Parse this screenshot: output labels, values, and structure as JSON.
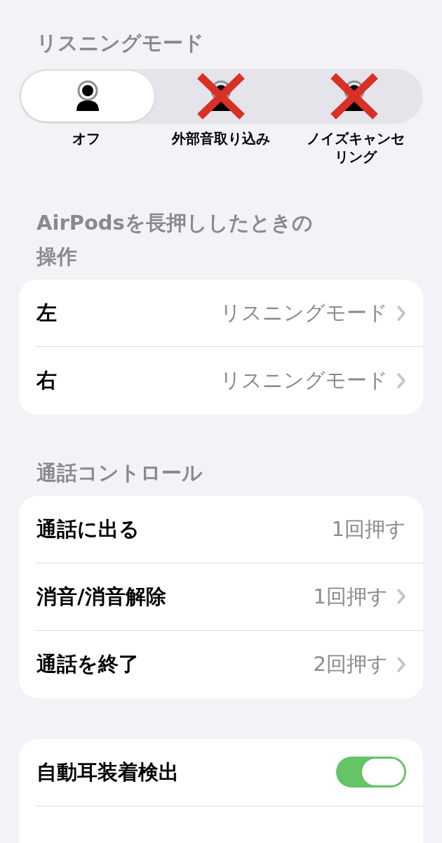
{
  "listening_mode": {
    "title": "リスニングモード",
    "segments": [
      {
        "label": "オフ",
        "selected": true,
        "crossed_out": false
      },
      {
        "label": "外部音取り込み",
        "selected": false,
        "crossed_out": true
      },
      {
        "label": "ノイズキャンセリング",
        "selected": false,
        "crossed_out": true
      }
    ]
  },
  "press_and_hold": {
    "title": "AirPodsを長押ししたときの操作",
    "rows": [
      {
        "label": "左",
        "value": "リスニングモード",
        "chevron": true
      },
      {
        "label": "右",
        "value": "リスニングモード",
        "chevron": true
      }
    ]
  },
  "call_controls": {
    "title": "通話コントロール",
    "rows": [
      {
        "label": "通話に出る",
        "value": "1回押す",
        "chevron": false
      },
      {
        "label": "消音/消音解除",
        "value": "1回押す",
        "chevron": true
      },
      {
        "label": "通話を終了",
        "value": "2回押す",
        "chevron": true
      }
    ]
  },
  "ear_detection": {
    "label": "自動耳装着検出",
    "on": true
  }
}
